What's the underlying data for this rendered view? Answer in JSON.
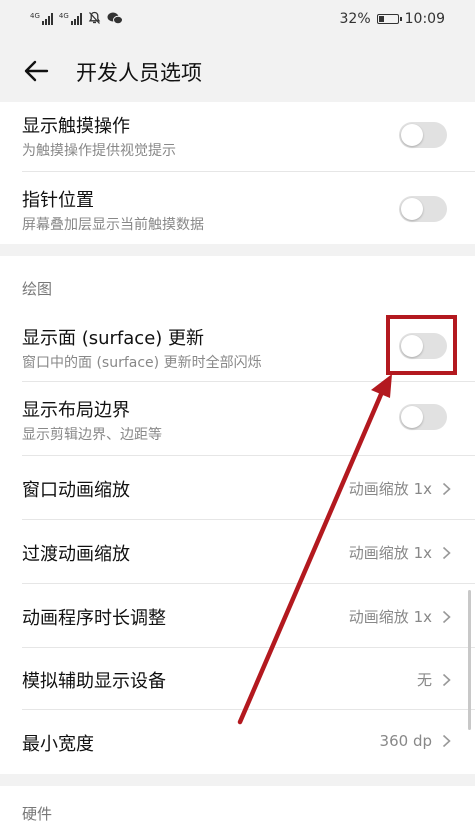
{
  "status": {
    "signal1": "4G",
    "signal2": "4G",
    "battery_percent": "32%",
    "battery_level": 0.32,
    "time": "10:09",
    "icons": [
      "signal-icon",
      "signal-icon",
      "mute-icon",
      "wechat-icon",
      "battery-icon"
    ]
  },
  "header": {
    "title": "开发人员选项"
  },
  "items": {
    "touches": {
      "title": "显示触摸操作",
      "subtitle": "为触摸操作提供视觉提示",
      "on": false
    },
    "pointer": {
      "title": "指针位置",
      "subtitle": "屏幕叠加层显示当前触摸数据",
      "on": false
    },
    "section_drawing": "绘图",
    "surface": {
      "title": "显示面 (surface) 更新",
      "subtitle": "窗口中的面 (surface) 更新时全部闪烁",
      "on": false
    },
    "layout": {
      "title": "显示布局边界",
      "subtitle": "显示剪辑边界、边距等",
      "on": false
    },
    "window_anim": {
      "title": "窗口动画缩放",
      "value": "动画缩放 1x"
    },
    "transition_anim": {
      "title": "过渡动画缩放",
      "value": "动画缩放 1x"
    },
    "animator_duration": {
      "title": "动画程序时长调整",
      "value": "动画缩放 1x"
    },
    "secondary_display": {
      "title": "模拟辅助显示设备",
      "value": "无"
    },
    "min_width": {
      "title": "最小宽度",
      "value": "360 dp"
    },
    "section_hardware": "硬件"
  },
  "colors": {
    "highlight": "#b3191f",
    "toggle_off": "#e1e1e1",
    "background": "#f2f2f2"
  }
}
